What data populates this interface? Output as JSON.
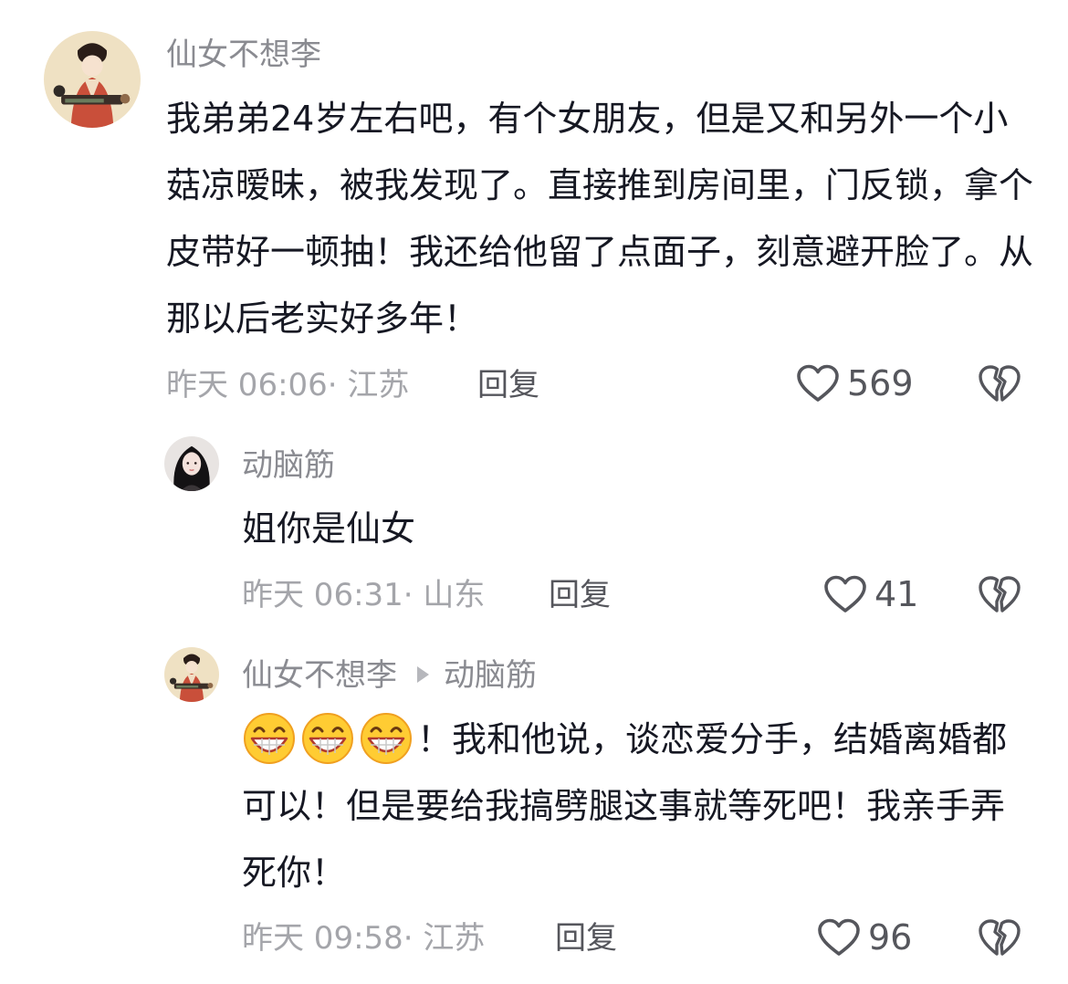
{
  "comments": [
    {
      "username": "仙女不想李",
      "text": "我弟弟24岁左右吧，有个女朋友，但是又和另外一个小菇凉暧昧，被我发现了。直接推到房间里，门反锁，拿个皮带好一顿抽！我还给他留了点面子，刻意避开脸了。从那以后老实好多年！",
      "meta": "昨天 06:06· 江苏",
      "reply_label": "回复",
      "likes": "569",
      "avatar_icon": "ancient-lady-painting-avatar"
    },
    {
      "username": "动脑筋",
      "text": "姐你是仙女",
      "meta": "昨天 06:31· 山东",
      "reply_label": "回复",
      "likes": "41",
      "avatar_icon": "girl-portrait-avatar"
    },
    {
      "username": "仙女不想李",
      "reply_to": "动脑筋",
      "emojis": [
        "grin-emoji",
        "grin-emoji",
        "grin-emoji"
      ],
      "text": "！我和他说，谈恋爱分手，结婚离婚都可以！但是要给我搞劈腿这事就等死吧！我亲手弄死你！",
      "meta": "昨天 09:58· 江苏",
      "reply_label": "回复",
      "likes": "96",
      "avatar_icon": "ancient-lady-painting-avatar"
    }
  ],
  "icons": {
    "like": "heart-outline-icon",
    "dislike": "broken-heart-icon"
  },
  "colors": {
    "username": "#8a8b91",
    "body": "#161823",
    "meta": "#a4a5aa",
    "action": "#55565c"
  }
}
